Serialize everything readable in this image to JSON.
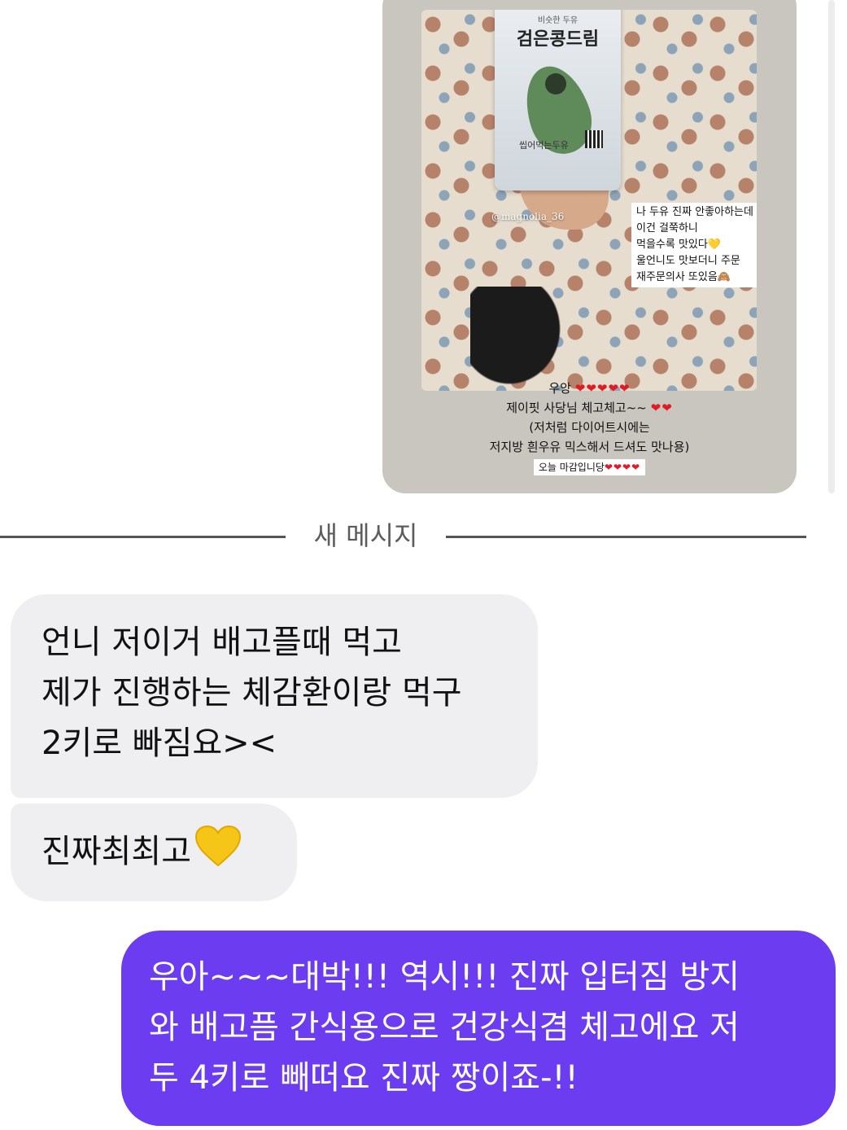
{
  "story": {
    "pouch_small_text": "비슷한 두유",
    "pouch_brand": "검은콩드림",
    "pouch_sub": "씹어먹는두유",
    "handle": "@magnolia_36",
    "caption_lines": [
      "나 두유 진짜 안좋아하는데",
      "이건 걸쭉하니",
      "먹을수록 맛있다💛",
      "울언니도 맛보더니 주문",
      "재주문의사 또있음🙈"
    ],
    "text_line1": "우앙",
    "text_line1_hearts": "❤❤❤❤❤",
    "text_line2": "제이핏 사당님 체고체고~~",
    "text_line2_hearts": "❤❤",
    "text_line3": "(저처럼 다이어트시에는",
    "text_line4": "저지방 흰우유 믹스해서 드셔도 맛나용)",
    "badge_text": "오늘 마감입니당",
    "badge_hearts": "❤❤❤❤"
  },
  "divider": {
    "label": "새 메시지"
  },
  "messages": {
    "incoming_1": [
      "언니 저이거 배고플때 먹고",
      "제가 진행하는 체감환이랑 먹구",
      "2키로 빠짐요><"
    ],
    "incoming_2": "진짜최최고",
    "outgoing_1": [
      "우아~~~대박!!! 역시!!! 진짜 입터짐 방지",
      "와 배고픔 간식용으로 건강식겸 체고에요 저",
      "두 4키로 빼떠요 진짜 짱이죠-!!"
    ]
  },
  "colors": {
    "outgoing_bubble": "#6b3cf0",
    "incoming_bubble": "#efeff1",
    "heart_red": "#e01b24",
    "heart_yellow": "#f5c518"
  }
}
